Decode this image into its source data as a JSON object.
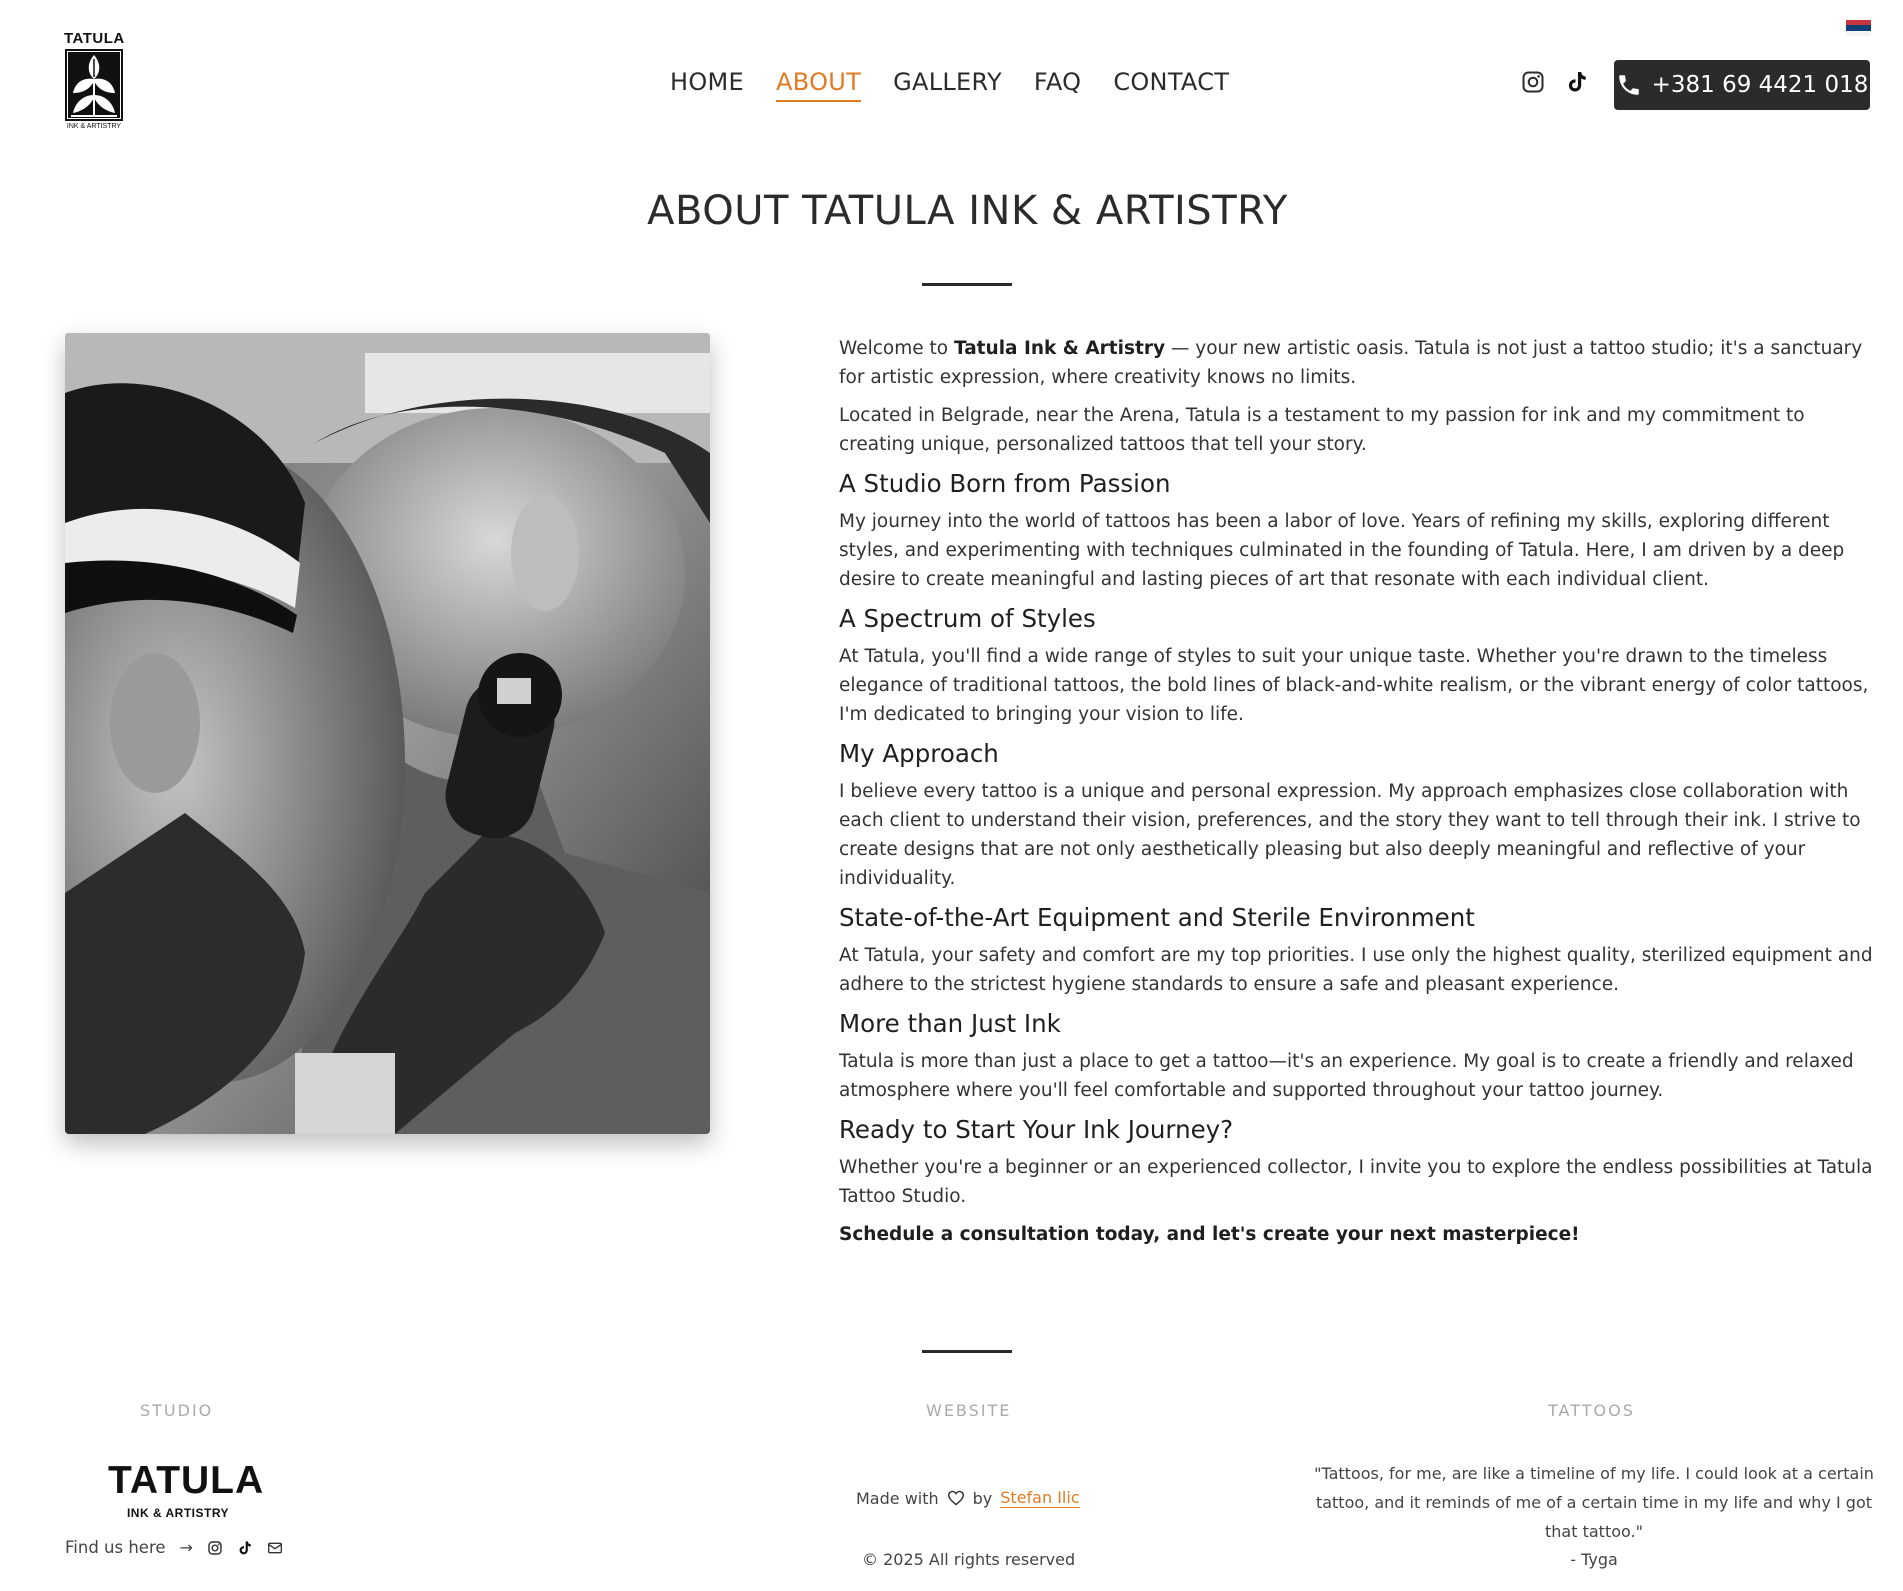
{
  "header": {
    "logo": {
      "word": "TATULA",
      "sub": "INK & ARTISTRY"
    },
    "nav": [
      {
        "label": "HOME"
      },
      {
        "label": "ABOUT"
      },
      {
        "label": "GALLERY"
      },
      {
        "label": "FAQ"
      },
      {
        "label": "CONTACT"
      }
    ],
    "active_nav": "ABOUT",
    "language_flag": "serbia-flag",
    "social": [
      "instagram-icon",
      "tiktok-icon"
    ],
    "phone_label": "+381 69 4421 018",
    "colors": {
      "accent": "#e07b23",
      "dark": "#2b2b2b"
    }
  },
  "page": {
    "title": "ABOUT TATULA INK & ARTISTRY"
  },
  "about": {
    "intro_prefix": "Welcome to ",
    "intro_brand": "Tatula Ink & Artistry",
    "intro_suffix": " — your new artistic oasis. Tatula is not just a tattoo studio; it's a sanctuary for artistic expression, where creativity knows no limits.",
    "location": "Located in Belgrade, near the Arena, Tatula is a testament to my passion for ink and my commitment to creating unique, personalized tattoos that tell your story.",
    "sections": [
      {
        "heading": "A Studio Born from Passion",
        "text": "My journey into the world of tattoos has been a labor of love. Years of refining my skills, exploring different styles, and experimenting with techniques culminated in the founding of Tatula. Here, I am driven by a deep desire to create meaningful and lasting pieces of art that resonate with each individual client."
      },
      {
        "heading": "A Spectrum of Styles",
        "text": "At Tatula, you'll find a wide range of styles to suit your unique taste. Whether you're drawn to the timeless elegance of traditional tattoos, the bold lines of black-and-white realism, or the vibrant energy of color tattoos, I'm dedicated to bringing your vision to life."
      },
      {
        "heading": "My Approach",
        "text": "I believe every tattoo is a unique and personal expression. My approach emphasizes close collaboration with each client to understand their vision, preferences, and the story they want to tell through their ink. I strive to create designs that are not only aesthetically pleasing but also deeply meaningful and reflective of your individuality."
      },
      {
        "heading": "State-of-the-Art Equipment and Sterile Environment",
        "text": "At Tatula, your safety and comfort are my top priorities. I use only the highest quality, sterilized equipment and adhere to the strictest hygiene standards to ensure a safe and pleasant experience."
      },
      {
        "heading": "More than Just Ink",
        "text": "Tatula is more than just a place to get a tattoo—it's an experience. My goal is to create a friendly and relaxed atmosphere where you'll feel comfortable and supported throughout your tattoo journey."
      },
      {
        "heading": "Ready to Start Your Ink Journey?",
        "text": "Whether you're a beginner or an experienced collector, I invite you to explore the endless possibilities at Tatula Tattoo Studio."
      }
    ],
    "cta": "Schedule a consultation today, and let's create your next masterpiece!"
  },
  "footer": {
    "studio": {
      "title": "STUDIO",
      "logo_big": "TATULA",
      "logo_small": "INK & ARTISTRY",
      "find_us": "Find us here",
      "arrow": "→",
      "icons": [
        "instagram-icon",
        "tiktok-icon",
        "mail-icon"
      ]
    },
    "website": {
      "title": "WEBSITE",
      "made_with": "Made with",
      "by": "by",
      "author": "Stefan Ilic",
      "copyright": "© 2025 All rights reserved"
    },
    "tattoos": {
      "title": "TATTOOS",
      "quote": "\"Tattoos, for me, are like a timeline of my life. I could look at a certain tattoo, and it reminds of me of a certain time in my life and why I got that tattoo.\"",
      "author": "- Tyga"
    }
  }
}
